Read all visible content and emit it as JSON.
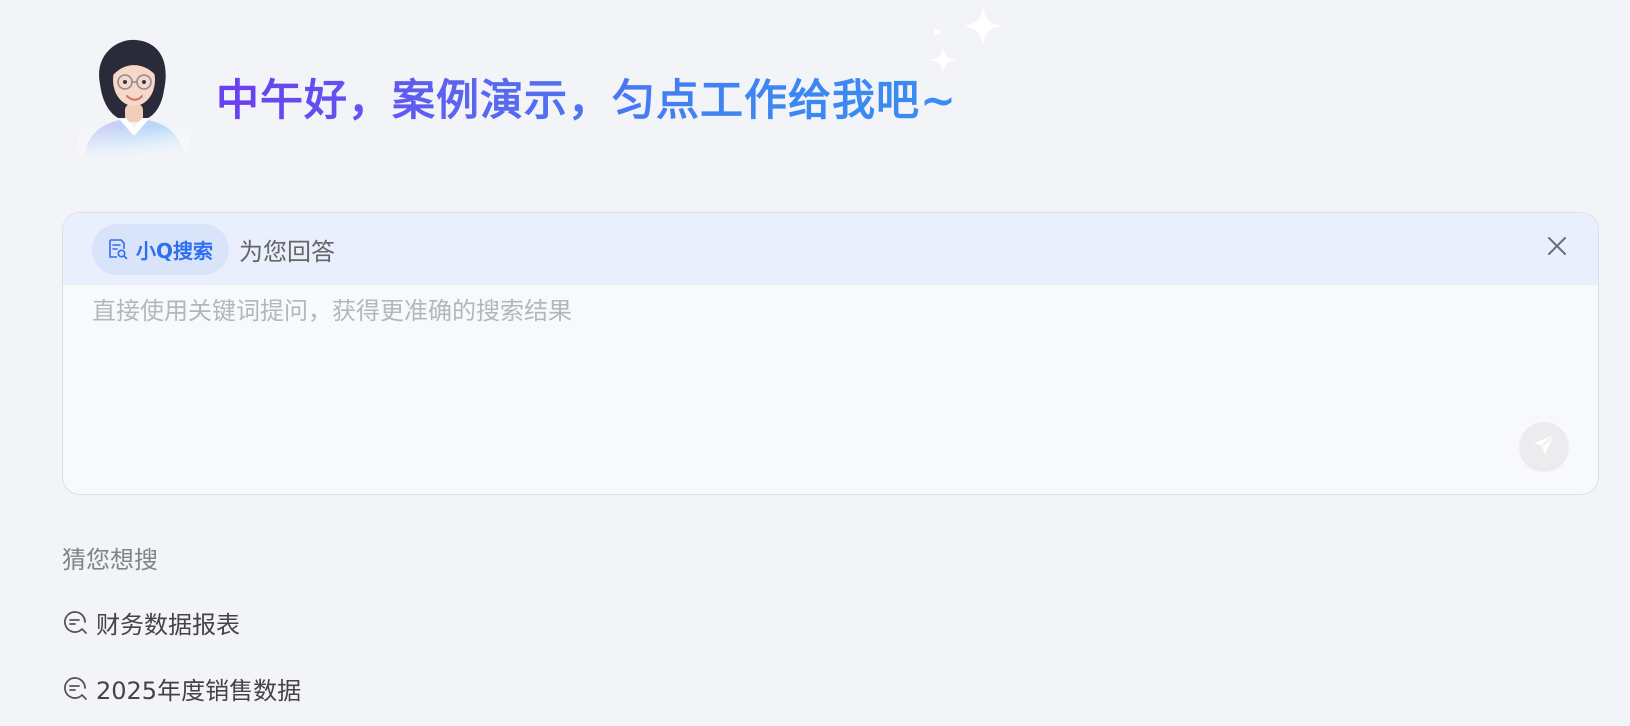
{
  "header": {
    "greeting": "中午好，案例演示，匀点工作给我吧~",
    "avatar_icon": "assistant-avatar",
    "sparkle_icon": "sparkle-icon"
  },
  "search": {
    "mode_icon": "search-document-icon",
    "mode_label": "小Q搜索",
    "mode_suffix": "为您回答",
    "placeholder": "直接使用关键词提问，获得更准确的搜索结果",
    "value": "",
    "close_icon": "close-icon",
    "send_icon": "send-icon"
  },
  "suggestions": {
    "title": "猜您想搜",
    "items": [
      {
        "label": "财务数据报表",
        "icon": "chat-search-icon"
      },
      {
        "label": "2025年度销售数据",
        "icon": "chat-search-icon"
      }
    ]
  },
  "colors": {
    "accent": "#2f6ff0",
    "greeting_gradient_start": "#6a3ef0",
    "greeting_gradient_end": "#3a8cf2",
    "page_background": "#f3f4f8"
  }
}
